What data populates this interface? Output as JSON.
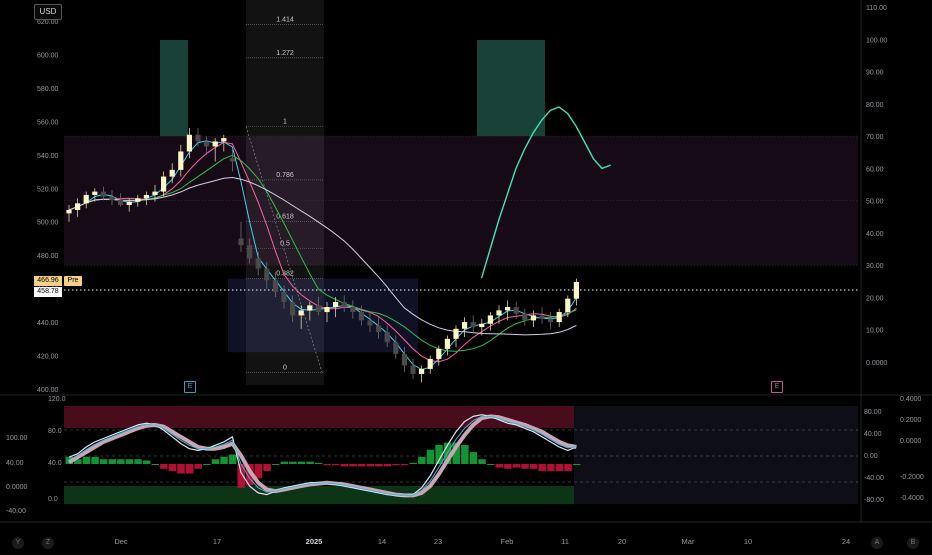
{
  "currency": "USD",
  "price_tags": {
    "last": "466.96",
    "close": "458.78",
    "session": "Pre"
  },
  "earnings_badge": "E",
  "corner_buttons": {
    "left_y": "Y",
    "left_z": "Z",
    "right_a": "A",
    "right_b": "B"
  },
  "colors": {
    "background": "#000000",
    "bull_candle": "#fff6c8",
    "bear_candle": "#4a4a4a",
    "fib_band": "#ffffff",
    "overbought": "#5b0f24",
    "oversold": "#0d3a1a",
    "teal_zone": "#1f4c42",
    "pink_zone": "#2a1229",
    "rsi_line": "#3ee6b0"
  },
  "chart_data": [
    {
      "type": "candlestick",
      "panel": "price",
      "y_axis_left": {
        "ticks": [
          "620.00",
          "600.00",
          "580.00",
          "560.00",
          "540.00",
          "520.00",
          "500.00",
          "480.00",
          "460.00",
          "440.00",
          "420.00",
          "400.00"
        ],
        "ylim": [
          400,
          620
        ]
      },
      "y_axis_right": {
        "ticks": [
          "110.00",
          "100.00",
          "90.00",
          "80.00",
          "70.00",
          "60.00",
          "50.00",
          "40.00",
          "30.00",
          "20.00",
          "10.00",
          "0.0000"
        ],
        "ylim": [
          -7,
          111
        ]
      },
      "x_axis": {
        "ticks": [
          "Dec",
          "17",
          "2025",
          "14",
          "23",
          "Feb",
          "11",
          "20",
          "Mar",
          "10",
          "24"
        ]
      },
      "fibonacci": [
        {
          "level": "1.414",
          "price": 618
        },
        {
          "level": "1.272",
          "price": 598
        },
        {
          "level": "1",
          "price": 557
        },
        {
          "level": "0.786",
          "price": 525
        },
        {
          "level": "0.618",
          "price": 500
        },
        {
          "level": "0.5",
          "price": 484
        },
        {
          "level": "0.382",
          "price": 466
        },
        {
          "level": "0",
          "price": 410
        }
      ],
      "candles": [
        [
          505,
          510,
          500,
          507
        ],
        [
          507,
          514,
          503,
          511
        ],
        [
          511,
          518,
          508,
          516
        ],
        [
          516,
          520,
          512,
          518
        ],
        [
          518,
          521,
          513,
          515
        ],
        [
          515,
          519,
          510,
          513
        ],
        [
          513,
          517,
          509,
          510
        ],
        [
          510,
          514,
          506,
          512
        ],
        [
          512,
          516,
          509,
          514
        ],
        [
          514,
          518,
          510,
          516
        ],
        [
          516,
          522,
          512,
          518
        ],
        [
          518,
          530,
          515,
          527
        ],
        [
          527,
          535,
          523,
          531
        ],
        [
          531,
          546,
          527,
          542
        ],
        [
          542,
          556,
          538,
          552
        ],
        [
          552,
          556,
          545,
          548
        ],
        [
          548,
          551,
          540,
          545
        ],
        [
          545,
          550,
          536,
          548
        ],
        [
          548,
          552,
          542,
          550
        ],
        [
          538,
          544,
          530,
          536
        ],
        [
          490,
          500,
          482,
          486
        ],
        [
          486,
          490,
          475,
          478
        ],
        [
          478,
          482,
          468,
          472
        ],
        [
          472,
          476,
          460,
          465
        ],
        [
          465,
          470,
          455,
          458
        ],
        [
          458,
          462,
          448,
          452
        ],
        [
          452,
          456,
          440,
          444
        ],
        [
          444,
          450,
          436,
          447
        ],
        [
          447,
          452,
          441,
          450
        ],
        [
          450,
          455,
          444,
          446
        ],
        [
          446,
          452,
          440,
          449
        ],
        [
          449,
          455,
          443,
          452
        ],
        [
          452,
          456,
          446,
          449
        ],
        [
          449,
          453,
          442,
          446
        ],
        [
          446,
          450,
          438,
          441
        ],
        [
          441,
          446,
          434,
          438
        ],
        [
          438,
          443,
          430,
          434
        ],
        [
          434,
          438,
          425,
          428
        ],
        [
          428,
          432,
          418,
          421
        ],
        [
          421,
          425,
          410,
          414
        ],
        [
          414,
          418,
          406,
          409
        ],
        [
          409,
          414,
          404,
          412
        ],
        [
          412,
          420,
          409,
          418
        ],
        [
          418,
          426,
          414,
          424
        ],
        [
          424,
          432,
          420,
          430
        ],
        [
          430,
          438,
          425,
          436
        ],
        [
          436,
          443,
          431,
          440
        ],
        [
          440,
          444,
          433,
          437
        ],
        [
          437,
          442,
          432,
          439
        ],
        [
          439,
          446,
          435,
          444
        ],
        [
          444,
          450,
          439,
          447
        ],
        [
          447,
          453,
          441,
          449
        ],
        [
          449,
          452,
          442,
          445
        ],
        [
          445,
          448,
          438,
          441
        ],
        [
          441,
          447,
          437,
          444
        ],
        [
          444,
          449,
          439,
          442
        ],
        [
          442,
          446,
          436,
          440
        ],
        [
          440,
          448,
          437,
          446
        ],
        [
          446,
          456,
          443,
          454
        ],
        [
          454,
          466,
          450,
          464
        ]
      ],
      "overlay_series": [
        {
          "name": "RSI",
          "axis": "right",
          "values": [
            null,
            null,
            null,
            null,
            null,
            null,
            null,
            null,
            null,
            null,
            null,
            null,
            null,
            null,
            null,
            null,
            null,
            null,
            null,
            null,
            null,
            null,
            null,
            null,
            null,
            null,
            null,
            null,
            null,
            null,
            null,
            null,
            null,
            null,
            null,
            null,
            null,
            null,
            null,
            null,
            null,
            26,
            35,
            44,
            52,
            60,
            66,
            71,
            75,
            78,
            79,
            77,
            73,
            68,
            63,
            60,
            61,
            null,
            null,
            null
          ]
        }
      ]
    },
    {
      "type": "area",
      "panel": "oscillator",
      "y_axis_left": {
        "ticks": [
          "120.0",
          "100.00",
          "80.0",
          "40.00",
          "40.0",
          "0.0000",
          "0.0",
          "-40.00"
        ],
        "ylim": [
          -40,
          120
        ]
      },
      "y_axis_right_inner": {
        "ticks": [
          "80.00",
          "40.00",
          "0.00",
          "-40.00",
          "-80.00"
        ]
      },
      "y_axis_right_outer": {
        "ticks": [
          "0.4000",
          "0.2000",
          "0.0000",
          "-0.2000",
          "-0.4000"
        ]
      },
      "series": [
        {
          "name": "K",
          "values": [
            48,
            52,
            60,
            66,
            70,
            74,
            78,
            82,
            86,
            88,
            86,
            80,
            72,
            64,
            58,
            56,
            58,
            62,
            66,
            72,
            30,
            14,
            6,
            4,
            8,
            12,
            14,
            16,
            18,
            18,
            17,
            16,
            14,
            12,
            10,
            8,
            6,
            4,
            3,
            2,
            4,
            12,
            26,
            44,
            62,
            78,
            90,
            96,
            98,
            96,
            92,
            88,
            86,
            82,
            78,
            72,
            66,
            60,
            56,
            60
          ]
        },
        {
          "name": "D",
          "values": [
            42,
            48,
            54,
            60,
            66,
            70,
            74,
            78,
            82,
            85,
            86,
            84,
            78,
            72,
            66,
            60,
            58,
            58,
            60,
            64,
            50,
            32,
            18,
            10,
            8,
            10,
            12,
            14,
            16,
            17,
            18,
            17,
            16,
            14,
            12,
            10,
            8,
            6,
            4,
            3,
            3,
            6,
            14,
            28,
            44,
            60,
            74,
            86,
            94,
            96,
            95,
            92,
            89,
            86,
            82,
            78,
            72,
            66,
            62,
            60
          ]
        }
      ]
    }
  ]
}
